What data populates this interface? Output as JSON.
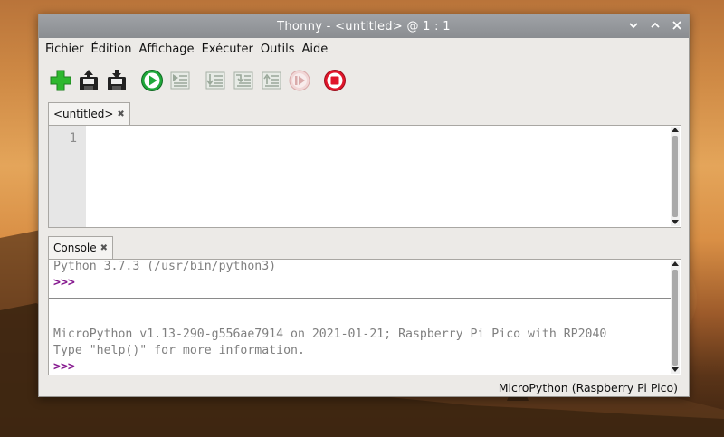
{
  "window": {
    "title": "Thonny  -  <untitled>  @  1 : 1",
    "controls": [
      "chevron-down-icon",
      "chevron-up-icon",
      "close-icon"
    ]
  },
  "menu": {
    "items": [
      "Fichier",
      "Édition",
      "Affichage",
      "Exécuter",
      "Outils",
      "Aide"
    ]
  },
  "toolbar": {
    "buttons": [
      {
        "icon": "new-file-icon",
        "enabled": true
      },
      {
        "icon": "open-file-icon",
        "enabled": true
      },
      {
        "icon": "save-file-icon",
        "enabled": true
      },
      {
        "icon": "run-icon",
        "enabled": true
      },
      {
        "icon": "debug-icon",
        "enabled": false
      },
      {
        "icon": "step-over-icon",
        "enabled": false
      },
      {
        "icon": "step-into-icon",
        "enabled": false
      },
      {
        "icon": "step-out-icon",
        "enabled": false
      },
      {
        "icon": "resume-icon",
        "enabled": false
      },
      {
        "icon": "stop-icon",
        "enabled": true
      }
    ],
    "colors": {
      "new": "#2eb82e",
      "run": "#1fa83a",
      "stop": "#e0162b",
      "disabled": "#9aa89a"
    }
  },
  "editor": {
    "tab_label": "<untitled>",
    "line_numbers": [
      "1"
    ],
    "content": ""
  },
  "shell": {
    "tab_label": "Console",
    "lines": {
      "python_version": "Python 3.7.3 (/usr/bin/python3)",
      "prompt1": ">>>",
      "micropython_version": "MicroPython v1.13-290-g556ae7914 on 2021-01-21; Raspberry Pi Pico with RP2040",
      "help_hint": "Type \"help()\" for more information.",
      "prompt2": ">>>"
    }
  },
  "status": {
    "interpreter": "MicroPython (Raspberry Pi Pico)"
  }
}
